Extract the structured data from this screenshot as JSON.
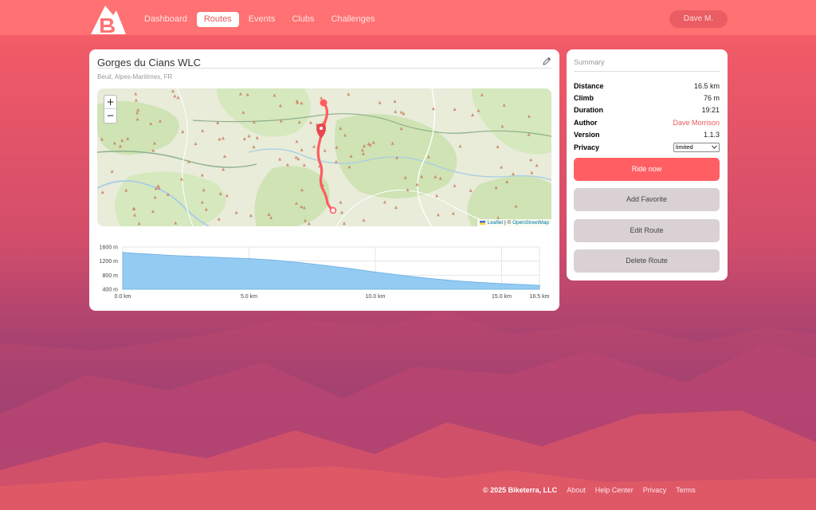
{
  "header": {
    "logo_icon": "biketerra-logo-icon",
    "nav": [
      {
        "label": "Dashboard",
        "active": false
      },
      {
        "label": "Routes",
        "active": true
      },
      {
        "label": "Events",
        "active": false
      },
      {
        "label": "Clubs",
        "active": false
      },
      {
        "label": "Challenges",
        "active": false
      }
    ],
    "user_label": "Dave M."
  },
  "route": {
    "title": "Gorges du Cians WLC",
    "location": "Beuil, Alpes-Maritimes, FR",
    "edit_icon": "pencil-icon"
  },
  "map": {
    "zoom_in": "+",
    "zoom_out": "−",
    "attribution_leaflet": "Leaflet",
    "attribution_sep": " | © ",
    "attribution_osm": "OpenStreetMap",
    "route_color": "#ff5c60"
  },
  "elevation": {
    "y_ticks": [
      "1600 m",
      "1200 m",
      "800 m",
      "400 m"
    ],
    "x_ticks": [
      "0.0 km",
      "5.0 km",
      "10.0 km",
      "15.0 km",
      "16.5 km"
    ]
  },
  "chart_data": {
    "type": "area",
    "x": [
      0,
      0.5,
      1,
      2,
      3,
      4,
      5,
      6,
      7,
      8,
      9,
      10,
      11,
      12,
      13,
      14,
      15,
      16,
      16.5
    ],
    "values": [
      1450,
      1420,
      1400,
      1360,
      1330,
      1300,
      1270,
      1230,
      1160,
      1080,
      990,
      890,
      800,
      720,
      650,
      600,
      560,
      530,
      510
    ],
    "xlabel": "",
    "ylabel": "",
    "xlim": [
      0,
      16.5
    ],
    "ylim": [
      400,
      1600
    ],
    "y_unit": "m",
    "x_unit": "km",
    "grid": true,
    "fill_color": "#94cbf3"
  },
  "summary": {
    "heading": "Summary",
    "stats": [
      {
        "label": "Distance",
        "value": "16.5 km"
      },
      {
        "label": "Climb",
        "value": "76 m"
      },
      {
        "label": "Duration",
        "value": "19:21"
      },
      {
        "label": "Author",
        "value": "Dave Morrison"
      },
      {
        "label": "Version",
        "value": "1.1.3"
      },
      {
        "label": "Privacy",
        "value": "limited"
      }
    ],
    "buttons": {
      "ride": "Ride now",
      "favorite": "Add Favorite",
      "edit": "Edit Route",
      "delete": "Delete Route"
    }
  },
  "footer": {
    "copyright": "© 2025 Biketerra, LLC",
    "links": [
      "About",
      "Help Center",
      "Privacy",
      "Terms"
    ]
  }
}
